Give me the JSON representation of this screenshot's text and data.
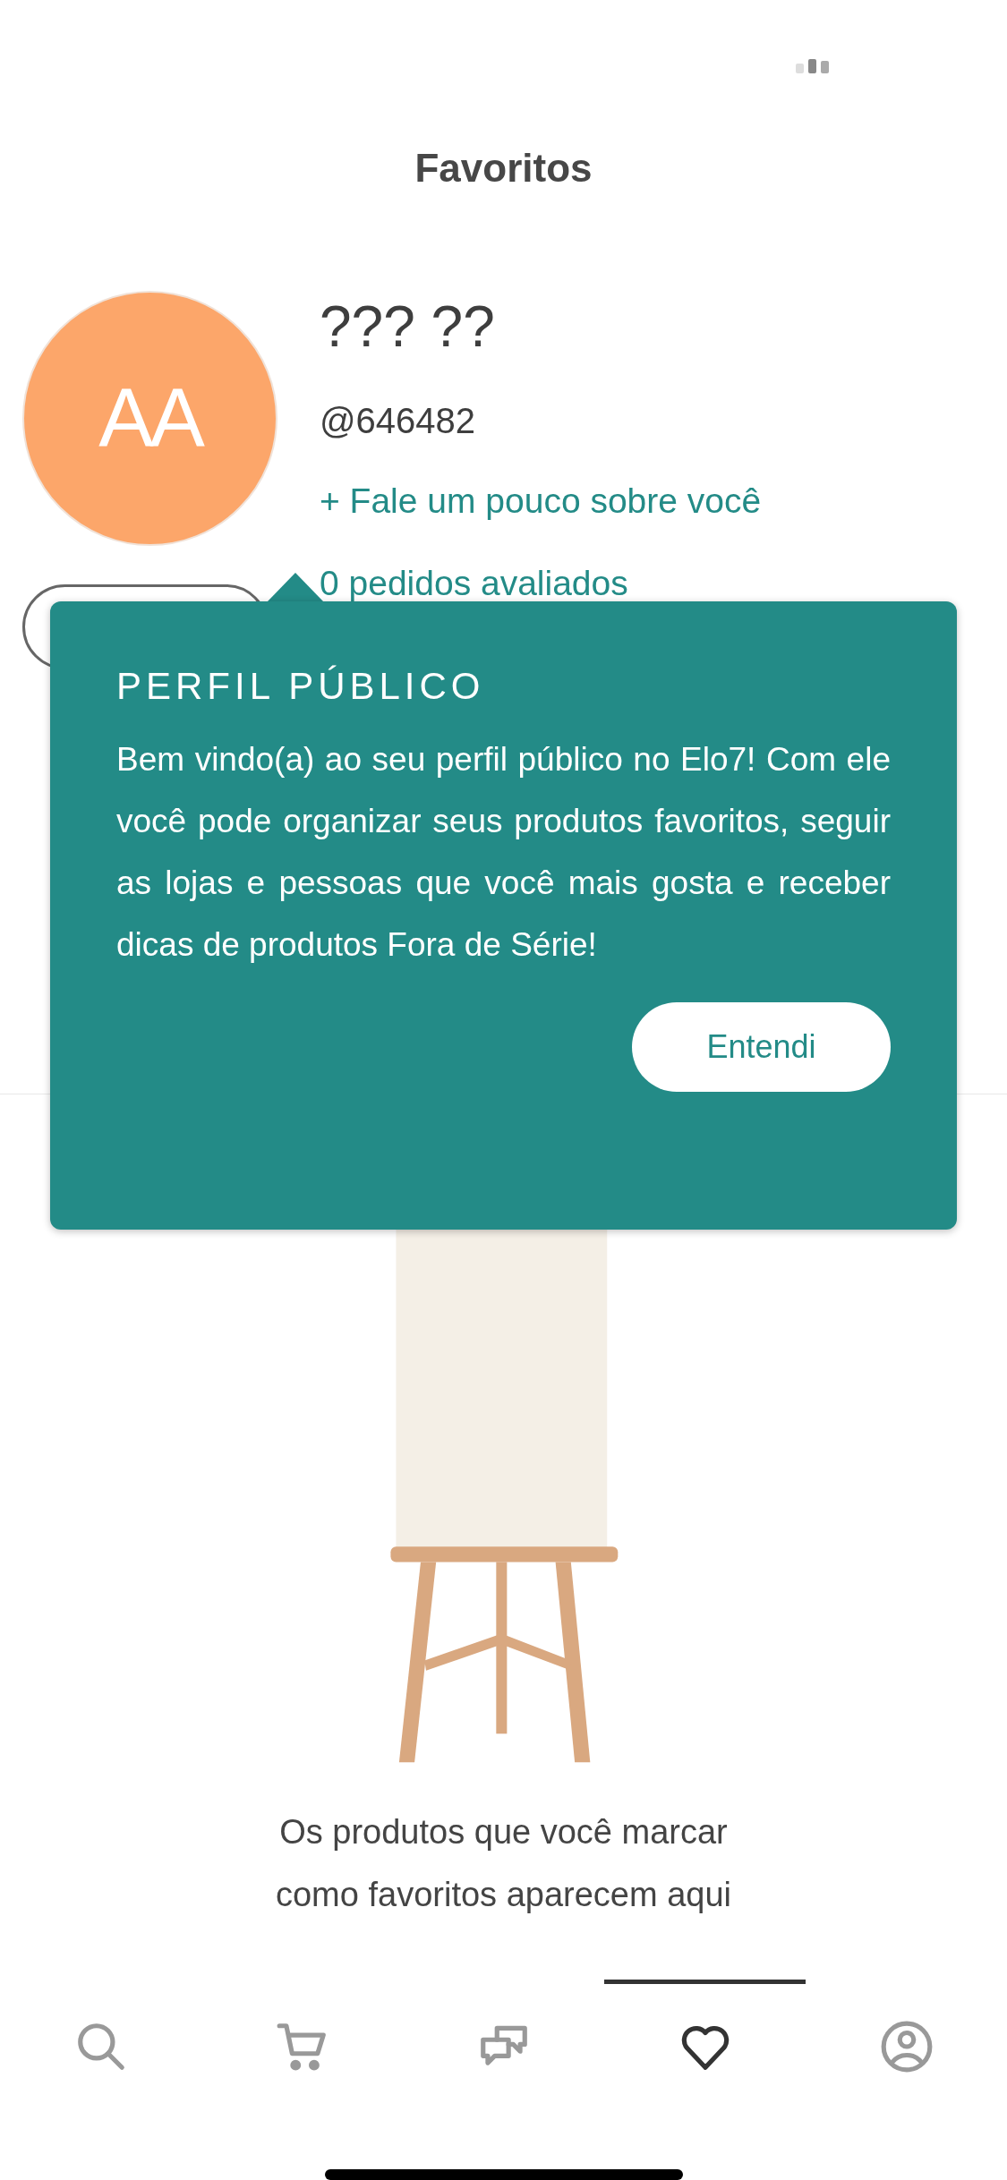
{
  "title": "Favoritos",
  "profile": {
    "initials": "AA",
    "name": "??? ??",
    "handle": "@646482",
    "about_link": "+ Fale um pouco sobre você",
    "reviews_link": "0 pedidos avaliados"
  },
  "tooltip": {
    "title": "PERFIL PÚBLICO",
    "body": "Bem vindo(a) ao seu perfil público no Elo7! Com ele você pode organizar seus produtos favoritos, seguir as lojas e pessoas que você mais gosta e receber dicas de produtos Fora de Série!",
    "button": "Entendi"
  },
  "empty_message": "Os produtos que você marcar como favoritos aparecem aqui",
  "tabs": [
    {
      "kind": "search",
      "selected": false
    },
    {
      "kind": "cart",
      "selected": false
    },
    {
      "kind": "chat",
      "selected": false
    },
    {
      "kind": "heart",
      "selected": true
    },
    {
      "kind": "profile",
      "selected": false
    }
  ]
}
